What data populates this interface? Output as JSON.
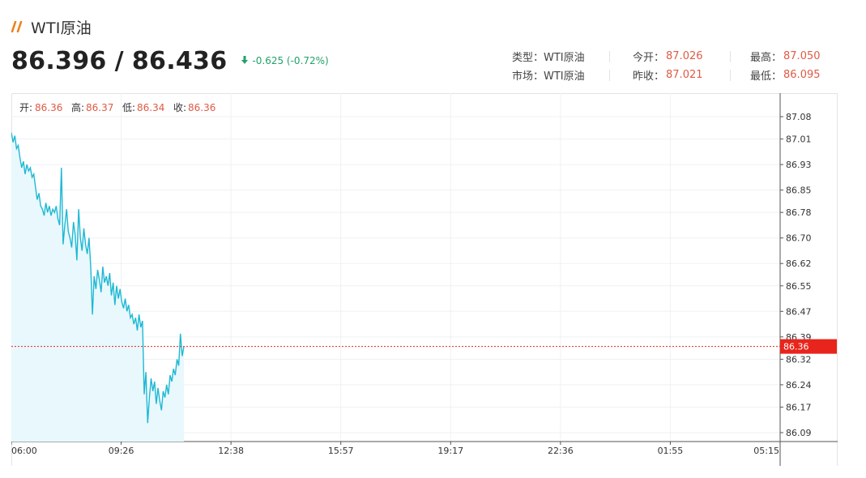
{
  "header": {
    "title": "WTI原油",
    "bid": "86.396",
    "separator": "/",
    "ask": "86.436",
    "change": "-0.625 (-0.72%)",
    "change_color": "#21a26a",
    "accent": "#f0821e"
  },
  "info": {
    "type_label": "类型：",
    "type_value": "WTI原油",
    "market_label": "市场：",
    "market_value": "WTI原油",
    "open_label": "今开：",
    "open_value": "87.026",
    "prev_close_label": "昨收：",
    "prev_close_value": "87.021",
    "high_label": "最高：",
    "high_value": "87.050",
    "low_label": "最低：",
    "low_value": "86.095"
  },
  "ohlc": {
    "open_label": "开:",
    "open_value": "86.36",
    "high_label": "高:",
    "high_value": "86.37",
    "low_label": "低:",
    "low_value": "86.34",
    "close_label": "收:",
    "close_value": "86.36"
  },
  "chart_data": {
    "type": "area",
    "x_ticks": [
      "06:00",
      "09:26",
      "12:38",
      "15:57",
      "19:17",
      "22:36",
      "01:55",
      "05:15"
    ],
    "y_ticks": [
      "87.08",
      "87.01",
      "86.93",
      "86.85",
      "86.78",
      "86.70",
      "86.62",
      "86.55",
      "86.47",
      "86.39",
      "86.32",
      "86.24",
      "86.17",
      "86.09"
    ],
    "ylim": [
      86.06,
      87.12
    ],
    "current_value": "86.36",
    "line_color": "#1fb8d4",
    "fill_color": "#e8f8fc",
    "marker_color": "#e8251c",
    "series": [
      {
        "x": [
          0,
          0.01,
          0.02,
          0.03,
          0.04,
          0.05,
          0.06,
          0.07,
          0.08,
          0.09,
          0.1,
          0.11,
          0.12,
          0.13,
          0.14,
          0.15,
          0.16,
          0.17,
          0.18,
          0.19,
          0.2,
          0.21,
          0.22,
          0.23,
          0.24,
          0.25,
          0.26,
          0.27,
          0.28,
          0.29,
          0.3,
          0.31,
          0.32,
          0.33,
          0.34,
          0.35,
          0.36,
          0.37,
          0.38,
          0.39,
          0.4,
          0.41,
          0.42,
          0.43,
          0.44,
          0.45,
          0.46,
          0.47,
          0.48,
          0.49,
          0.5,
          0.51,
          0.52,
          0.53,
          0.54,
          0.55,
          0.56,
          0.57,
          0.58,
          0.59,
          0.6,
          0.61,
          0.62,
          0.63,
          0.64,
          0.65,
          0.66,
          0.67,
          0.68,
          0.69,
          0.7,
          0.71,
          0.72,
          0.73,
          0.74,
          0.75,
          0.76,
          0.77,
          0.78,
          0.79,
          0.8,
          0.81,
          0.82,
          0.83,
          0.84,
          0.85,
          0.86,
          0.87,
          0.88,
          0.89,
          0.9,
          0.91,
          0.92,
          0.93,
          0.94,
          0.95,
          0.96,
          0.97,
          0.98,
          0.99,
          1.0
        ],
        "values": [
          87.03,
          87.0,
          87.02,
          86.98,
          86.99,
          86.95,
          86.92,
          86.94,
          86.9,
          86.93,
          86.91,
          86.92,
          86.89,
          86.9,
          86.86,
          86.82,
          86.84,
          86.8,
          86.79,
          86.77,
          86.81,
          86.78,
          86.8,
          86.77,
          86.79,
          86.78,
          86.8,
          86.76,
          86.74,
          86.92,
          86.68,
          86.74,
          86.79,
          86.72,
          86.7,
          86.67,
          86.75,
          86.71,
          86.63,
          86.79,
          86.7,
          86.66,
          86.73,
          86.68,
          86.65,
          86.7,
          86.61,
          86.46,
          86.58,
          86.54,
          86.6,
          86.57,
          86.53,
          86.61,
          86.56,
          86.58,
          86.55,
          86.59,
          86.52,
          86.56,
          86.49,
          86.55,
          86.51,
          86.54,
          86.5,
          86.48,
          86.51,
          86.47,
          86.49,
          86.45,
          86.46,
          86.43,
          86.45,
          86.41,
          86.46,
          86.42,
          86.44,
          86.21,
          86.28,
          86.12,
          86.2,
          86.26,
          86.22,
          86.25,
          86.18,
          86.23,
          86.19,
          86.16,
          86.22,
          86.2,
          86.24,
          86.21,
          86.27,
          86.25,
          86.29,
          86.27,
          86.32,
          86.3,
          86.4,
          86.33,
          86.36
        ]
      }
    ]
  }
}
